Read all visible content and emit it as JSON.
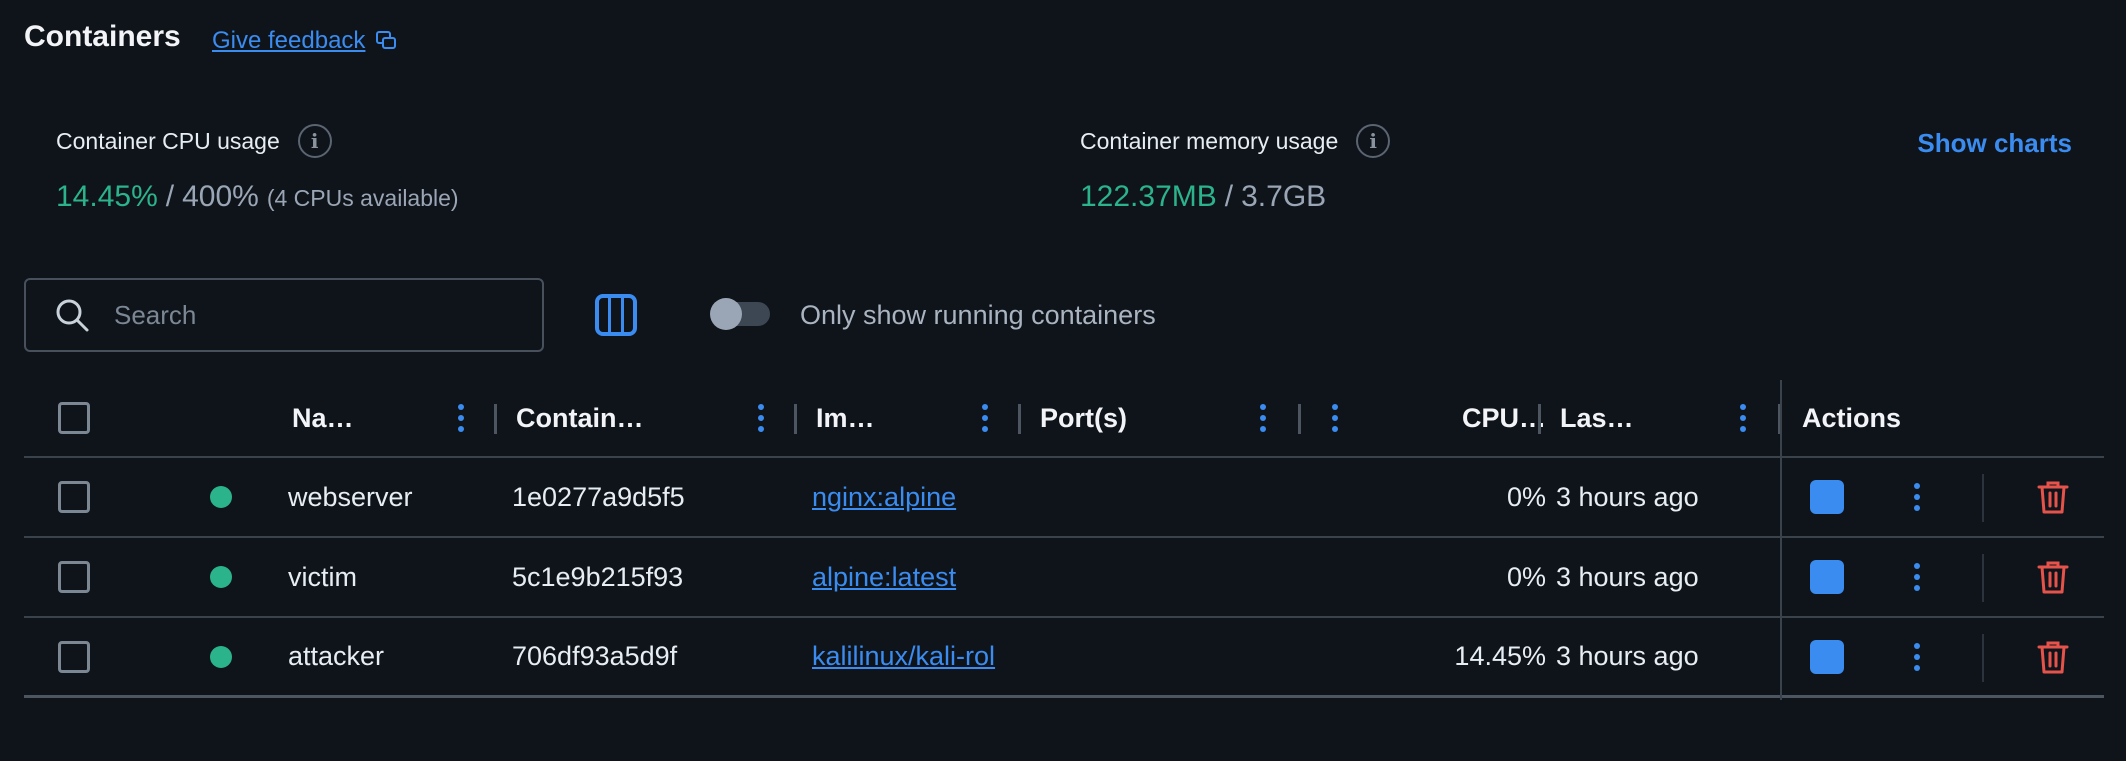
{
  "header": {
    "title": "Containers",
    "feedback_label": "Give feedback"
  },
  "stats": {
    "cpu": {
      "label": "Container CPU usage",
      "used": "14.45%",
      "separator": "/",
      "total": "400%",
      "note": "(4 CPUs available)"
    },
    "memory": {
      "label": "Container memory usage",
      "used": "122.37MB",
      "separator": "/",
      "total": "3.7GB"
    },
    "show_charts_label": "Show charts"
  },
  "toolbar": {
    "search_placeholder": "Search",
    "toggle_label": "Only show running containers",
    "toggle_on": false
  },
  "table": {
    "columns": {
      "name": "Na…",
      "container_id": "Contain…",
      "image": "Im…",
      "ports": "Port(s)",
      "cpu": "CPU…",
      "last_started": "Las…",
      "actions": "Actions"
    },
    "rows": [
      {
        "name": "webserver",
        "container_id": "1e0277a9d5f5",
        "image": "nginx:alpine",
        "ports": "",
        "cpu": "0%",
        "last_started": "3 hours ago",
        "status": "running"
      },
      {
        "name": "victim",
        "container_id": "5c1e9b215f93",
        "image": "alpine:latest",
        "ports": "",
        "cpu": "0%",
        "last_started": "3 hours ago",
        "status": "running"
      },
      {
        "name": "attacker",
        "container_id": "706df93a5d9f",
        "image": "kalilinux/kali-rol",
        "ports": "",
        "cpu": "14.45%",
        "last_started": "3 hours ago",
        "status": "running"
      }
    ]
  },
  "colors": {
    "accent": "#3b8cf0",
    "running": "#2bb38b",
    "danger": "#e5534b",
    "background": "#0f141b"
  }
}
